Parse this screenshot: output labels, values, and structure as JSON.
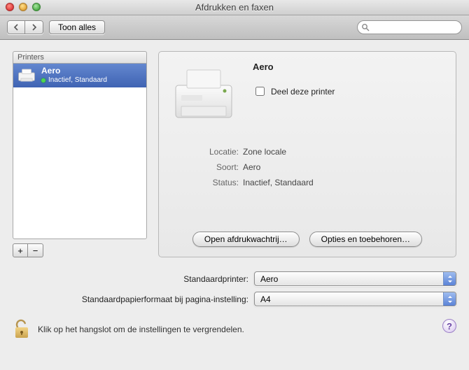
{
  "window": {
    "title": "Afdrukken en faxen"
  },
  "toolbar": {
    "show_all_label": "Toon alles",
    "search_placeholder": ""
  },
  "sidebar": {
    "header": "Printers",
    "items": [
      {
        "name": "Aero",
        "status": "Inactief, Standaard"
      }
    ],
    "add_label": "+",
    "remove_label": "−"
  },
  "details": {
    "name": "Aero",
    "share_label": "Deel deze printer",
    "share_checked": false,
    "location_label": "Locatie:",
    "location_value": "Zone locale",
    "kind_label": "Soort:",
    "kind_value": "Aero",
    "status_label": "Status:",
    "status_value": "Inactief, Standaard",
    "open_queue_button": "Open afdrukwachtrij…",
    "options_button": "Opties en toebehoren…"
  },
  "defaults": {
    "default_printer_label": "Standaardprinter:",
    "default_printer_value": "Aero",
    "paper_label": "Standaardpapierformaat bij pagina-instelling:",
    "paper_value": "A4"
  },
  "lock": {
    "text": "Klik op het hangslot om de instellingen te vergrendelen.",
    "help": "?"
  }
}
